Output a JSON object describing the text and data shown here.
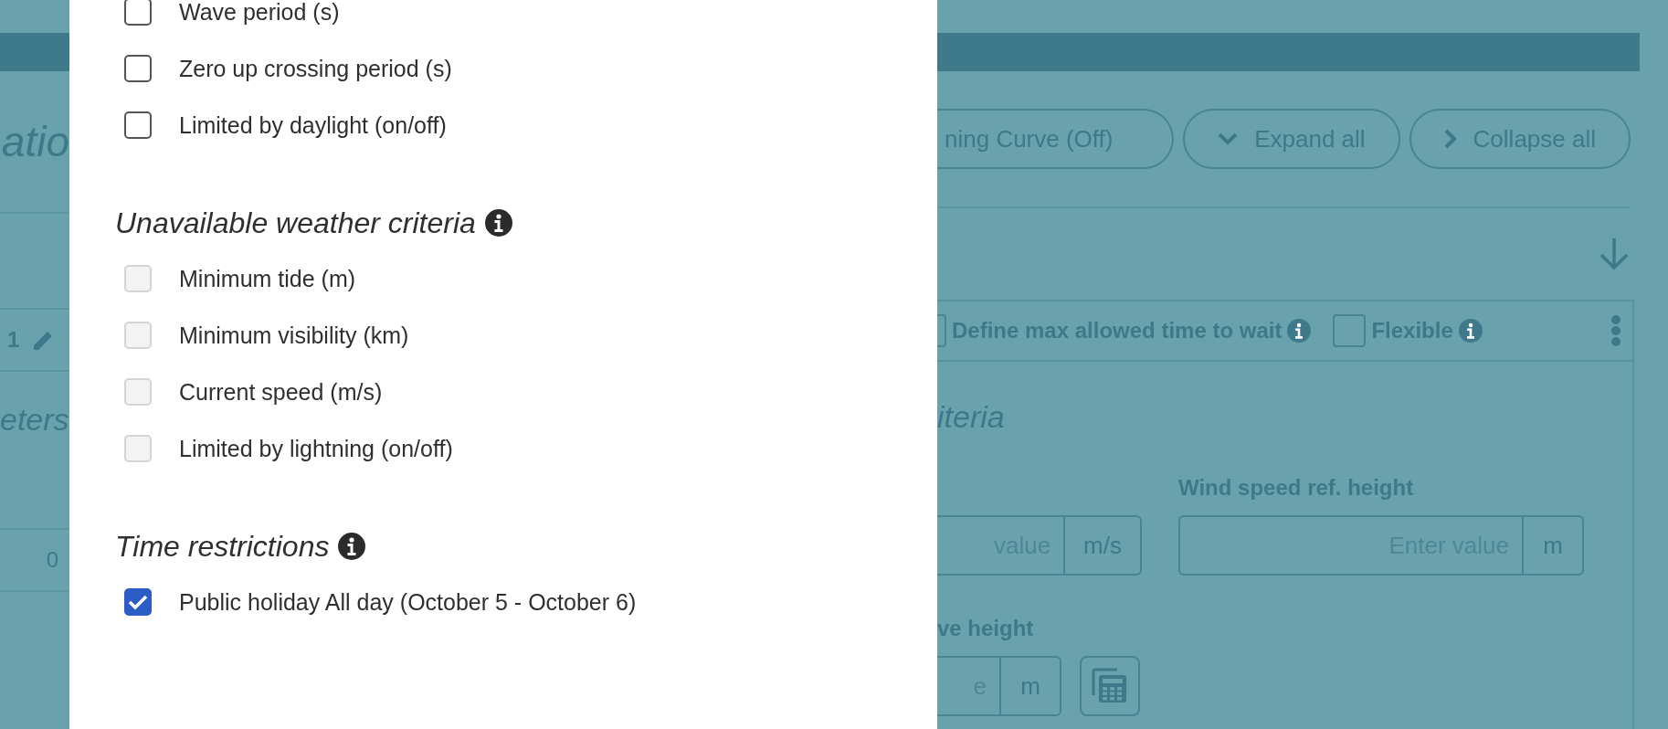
{
  "background": {
    "left": {
      "heading": "atio",
      "row_number": "1",
      "subheading": "eters",
      "value": "0"
    },
    "toolbar": {
      "buttons": [
        {
          "label": "ning Curve (Off)",
          "kind": "toggle"
        },
        {
          "label": "Expand all",
          "kind": "expand"
        },
        {
          "label": "Collapse all",
          "kind": "collapse"
        }
      ]
    },
    "row_options": [
      {
        "label": "Define max allowed time to wait",
        "checked": false
      },
      {
        "label": "Flexible",
        "checked": false
      }
    ],
    "criteria_heading": "iteria",
    "fields": [
      {
        "placeholder": "value",
        "unit": "m/s"
      },
      {
        "label": "Wind speed ref. height",
        "placeholder": "Enter value",
        "unit": "m"
      },
      {
        "label": "ve height",
        "placeholder": "e",
        "unit": "m"
      }
    ]
  },
  "modal": {
    "sections": [
      {
        "items": [
          {
            "label": "Wave period (s)",
            "checked": false,
            "disabled": false
          },
          {
            "label": "Zero up crossing period (s)",
            "checked": false,
            "disabled": false
          },
          {
            "label": "Limited by daylight (on/off)",
            "checked": false,
            "disabled": false
          }
        ]
      },
      {
        "title": "Unavailable weather criteria",
        "items": [
          {
            "label": "Minimum tide (m)",
            "checked": false,
            "disabled": true
          },
          {
            "label": "Minimum visibility (km)",
            "checked": false,
            "disabled": true
          },
          {
            "label": "Current speed (m/s)",
            "checked": false,
            "disabled": true
          },
          {
            "label": "Limited by lightning (on/off)",
            "checked": false,
            "disabled": true
          }
        ]
      },
      {
        "title": "Time restrictions",
        "items": [
          {
            "label": "Public holiday All day (October 5 - October 6)",
            "checked": true,
            "disabled": false
          }
        ]
      }
    ]
  }
}
